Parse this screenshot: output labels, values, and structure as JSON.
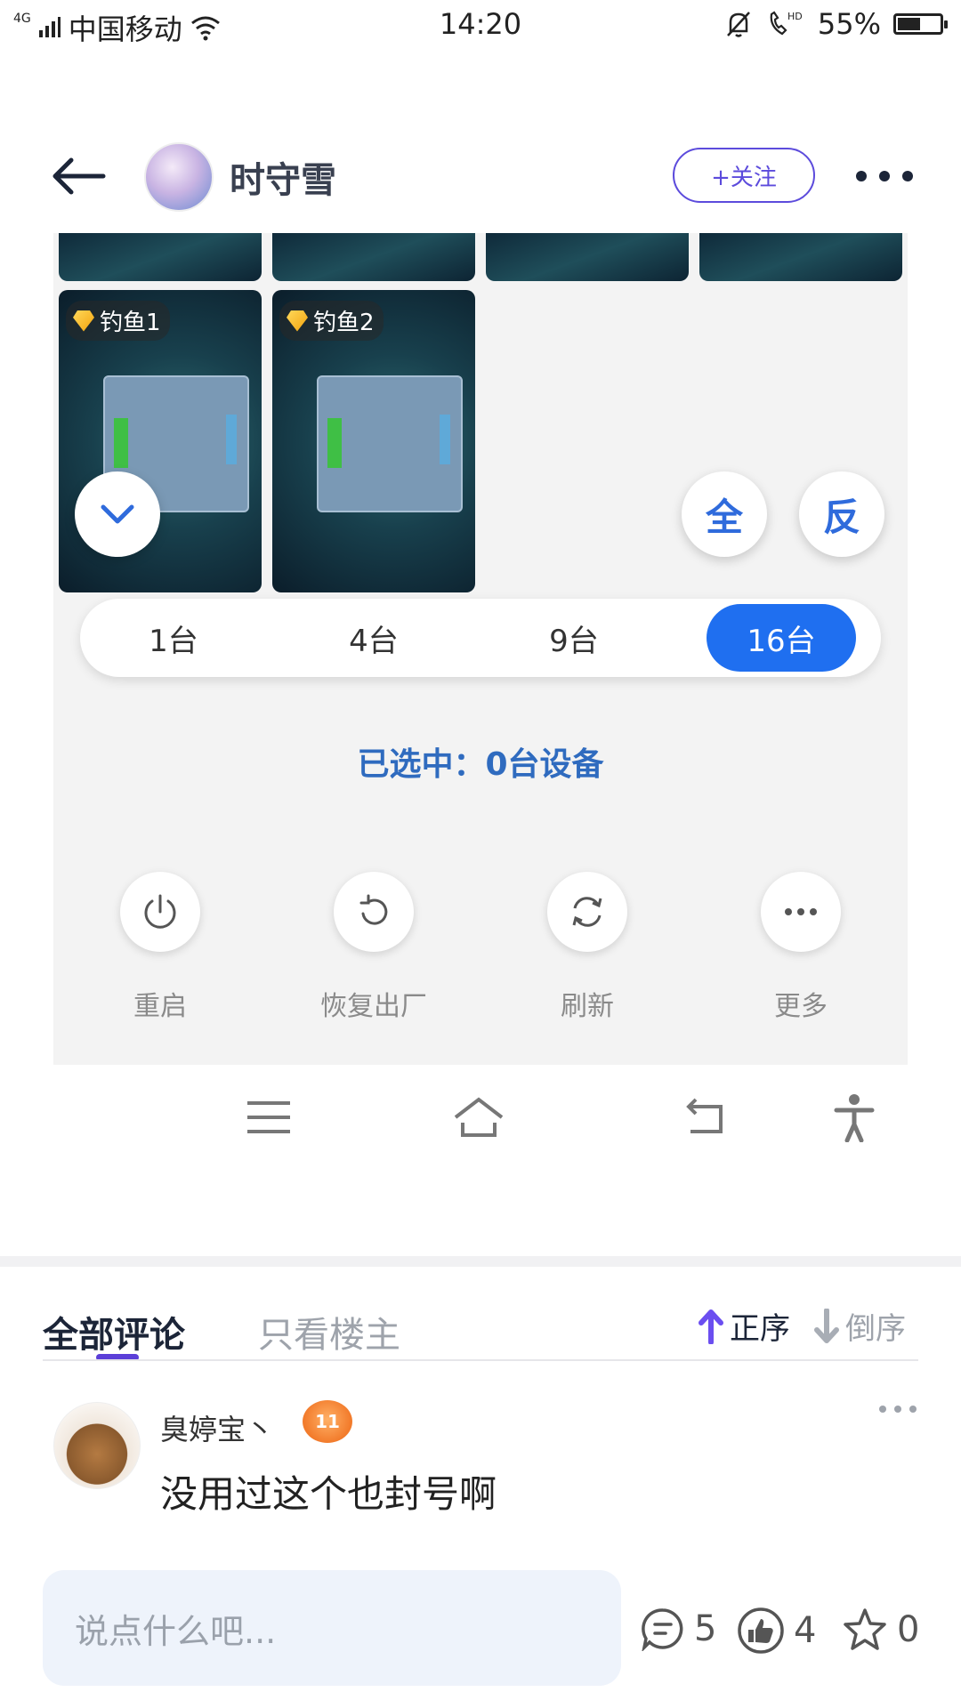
{
  "status_bar": {
    "network": "4G",
    "carrier": "中国移动",
    "time": "14:20",
    "battery": "55%",
    "battery_level": 0.55
  },
  "header": {
    "user_name": "时守雪",
    "follow_label": "+关注"
  },
  "panel": {
    "devices": [
      {
        "label": "钓鱼1"
      },
      {
        "label": "钓鱼2"
      }
    ],
    "select_all_label": "全",
    "invert_label": "反",
    "segments": [
      "1台",
      "4台",
      "9台",
      "16台"
    ],
    "active_segment": "16台",
    "selected_info": "已选中：0台设备",
    "actions": [
      {
        "label": "重启",
        "icon": "power-icon"
      },
      {
        "label": "恢复出厂",
        "icon": "reset-icon"
      },
      {
        "label": "刷新",
        "icon": "refresh-icon"
      },
      {
        "label": "更多",
        "icon": "more-icon"
      }
    ]
  },
  "comments": {
    "tab_all": "全部评论",
    "tab_owner": "只看楼主",
    "sort_asc": "正序",
    "sort_desc": "倒序",
    "items": [
      {
        "user": "臭婷宝丶",
        "level": "11",
        "text": "没用过这个也封号啊"
      }
    ]
  },
  "footer": {
    "input_placeholder": "说点什么吧...",
    "comment_count": "5",
    "like_count": "4",
    "star_count": "0"
  },
  "colors": {
    "accent": "#5c4bdc",
    "segment_active": "#1f6ff0",
    "selected_text": "#2f6bbf"
  }
}
